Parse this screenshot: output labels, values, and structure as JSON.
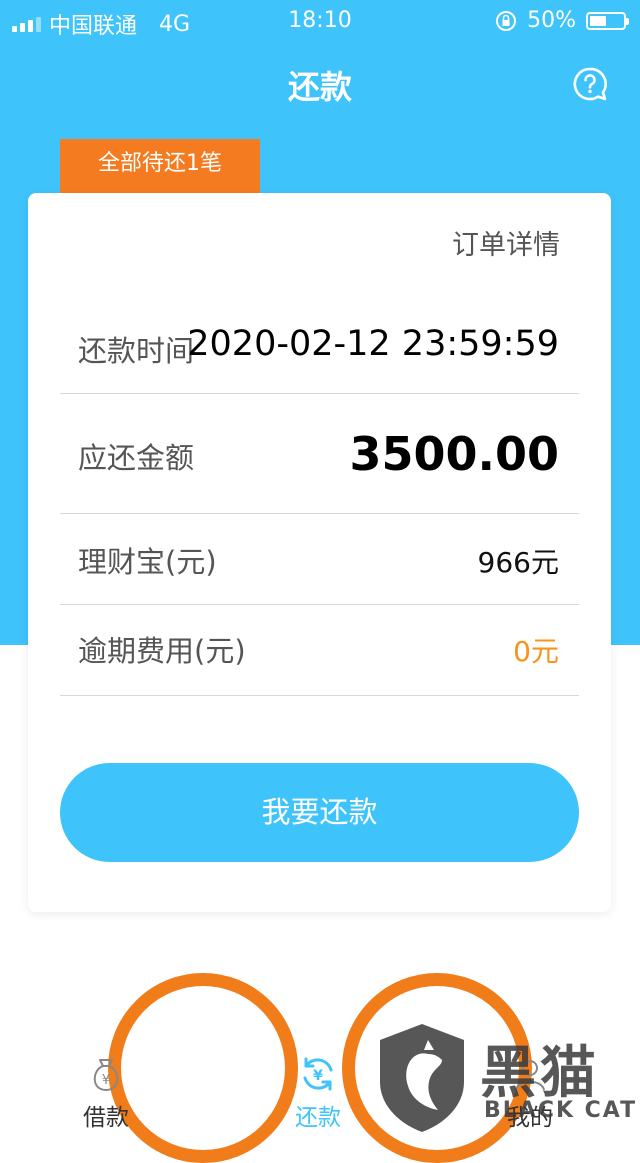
{
  "status_bar": {
    "carrier": "中国联通",
    "network": "4G",
    "time": "18:10",
    "battery": "50%",
    "battery_level": 0.5
  },
  "header": {
    "title": "还款",
    "help_icon": "question-bubble-icon"
  },
  "pending_tag": "全部待还1笔",
  "card": {
    "order_detail": "订单详情",
    "rows": [
      {
        "label": "还款时间",
        "value": "2020-02-12 23:59:59"
      },
      {
        "label": "应还金额",
        "value": "3500.00"
      },
      {
        "label": "理财宝(元)",
        "value": "966元"
      },
      {
        "label": "逾期费用(元)",
        "value": "0元"
      }
    ],
    "repay_button": "我要还款"
  },
  "tabbar": {
    "items": [
      {
        "label": "借款",
        "icon": "money-bag-icon"
      },
      {
        "label": "还款",
        "icon": "refresh-yen-icon",
        "active": true
      },
      {
        "label": "我的",
        "icon": "user-icon"
      }
    ]
  },
  "watermark": {
    "text": "黑猫",
    "sub": "BLACK CAT"
  },
  "colors": {
    "primary": "#3ec4fb",
    "accent_orange": "#f47b20",
    "overdue_orange": "#f7941d"
  }
}
